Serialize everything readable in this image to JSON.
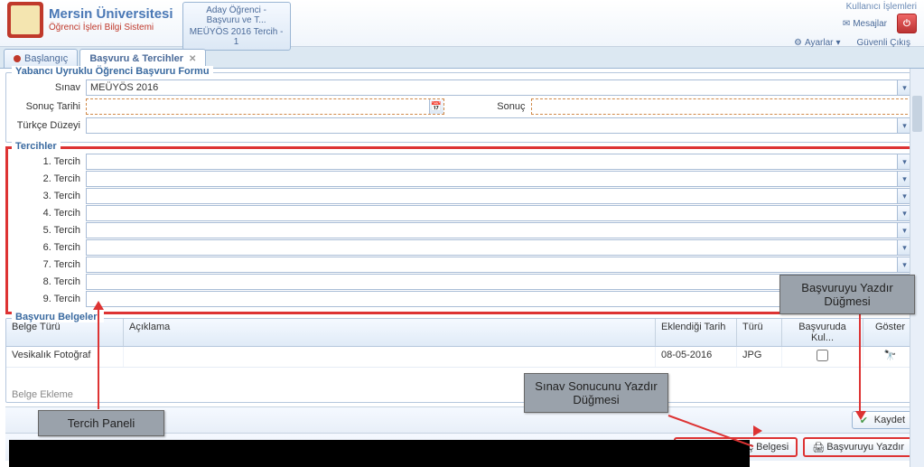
{
  "header": {
    "uni_name": "Mersin Üniversitesi",
    "system_name": "Öğrenci İşleri Bilgi Sistemi",
    "open_tab_line1": "Aday Öğrenci - Başvuru ve T...",
    "open_tab_line2": "MEÜYÖS 2016 Tercih - 1",
    "user_ops_title": "Kullanıcı İşlemleri",
    "mesajlar": "Mesajlar",
    "ayarlar": "Ayarlar",
    "cikis": "Güvenli Çıkış"
  },
  "tabs": {
    "baslangic": "Başlangıç",
    "basvuru": "Başvuru & Tercihler"
  },
  "form": {
    "title": "Yabancı Uyruklu Öğrenci Başvuru Formu",
    "sinav_label": "Sınav",
    "sinav_value": "MEÜYÖS 2016",
    "sonuc_tarihi_label": "Sonuç Tarihi",
    "sonuc_label": "Sonuç",
    "turkce_label": "Türkçe Düzeyi"
  },
  "tercihler": {
    "title": "Tercihler",
    "items": [
      {
        "label": "1. Tercih"
      },
      {
        "label": "2. Tercih"
      },
      {
        "label": "3. Tercih"
      },
      {
        "label": "4. Tercih"
      },
      {
        "label": "5. Tercih"
      },
      {
        "label": "6. Tercih"
      },
      {
        "label": "7. Tercih"
      },
      {
        "label": "8. Tercih"
      },
      {
        "label": "9. Tercih"
      }
    ]
  },
  "belgeler": {
    "title": "Başvuru Belgeleri",
    "cols": {
      "belge": "Belge Türü",
      "aciklama": "Açıklama",
      "tarih": "Eklendiği Tarih",
      "turu": "Türü",
      "kul": "Başvuruda Kul...",
      "goster": "Göster"
    },
    "rows": [
      {
        "belge": "Vesikalık Fotoğraf",
        "aciklama": "",
        "tarih": "08-05-2016",
        "turu": "JPG",
        "kul": false
      }
    ],
    "belge_ekleme": "Belge Ekleme"
  },
  "buttons": {
    "kaydet": "Kaydet",
    "sinav_sonuc": "Sınav Sonuç Belgesi",
    "basvuru_yazdir": "Başvuruyu Yazdır"
  },
  "callouts": {
    "tercih_paneli": "Tercih Paneli",
    "sinav_sonucu": "Sınav Sonucunu Yazdır Düğmesi",
    "basvuru_yazdir": "Başvuruyu Yazdır Düğmesi"
  }
}
